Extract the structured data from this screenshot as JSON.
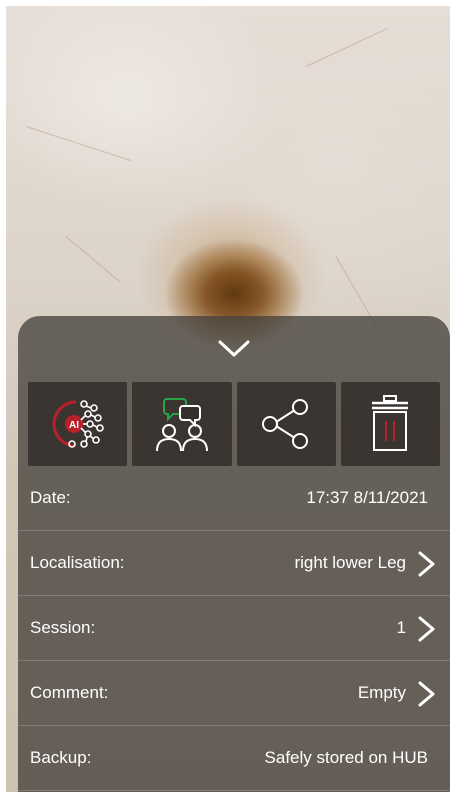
{
  "photo": {
    "subject": "dermoscopy-lesion-image"
  },
  "sheet": {
    "collapse_icon": "chevron-down-icon",
    "actions": [
      {
        "name": "ai-analysis",
        "icon": "ai-network-icon",
        "accent": "#b8202a"
      },
      {
        "name": "consult",
        "icon": "consultation-icon",
        "accent": "#2aa24a"
      },
      {
        "name": "share",
        "icon": "share-icon",
        "accent": "#ffffff"
      },
      {
        "name": "delete",
        "icon": "trash-icon",
        "accent": "#b8202a"
      }
    ],
    "rows": [
      {
        "label": "Date:",
        "value": "17:37 8/11/2021"
      },
      {
        "label": "Localisation:",
        "value": "right lower Leg"
      },
      {
        "label": "Session:",
        "value": "1"
      },
      {
        "label": "Comment:",
        "value": "Empty"
      },
      {
        "label": "Backup:",
        "value": "Safely stored on HUB"
      }
    ]
  },
  "colors": {
    "sheet_bg": "#46423e",
    "text": "#ffffff",
    "ai_red": "#b8202a",
    "chat_green": "#2aa24a"
  }
}
